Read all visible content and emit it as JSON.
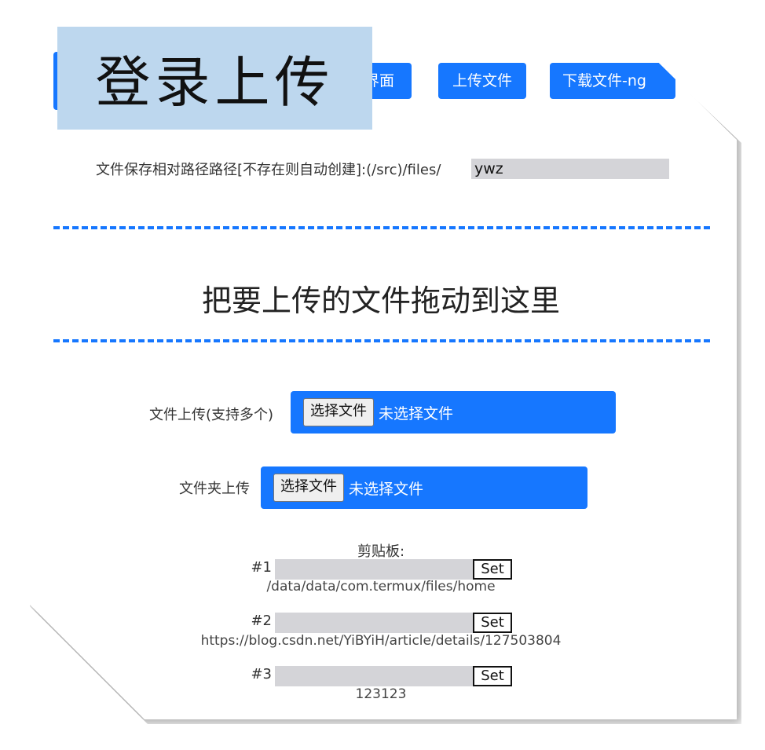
{
  "overlay": {
    "title": "登录上传"
  },
  "nav": {
    "login_label": "",
    "ui_label": "界面",
    "upload_label": "上传文件",
    "download_label": "下载文件-ng"
  },
  "path": {
    "label": "文件保存相对路径路径[不存在则自动创建]:(/src)/files/",
    "value": "ywz"
  },
  "dropzone": {
    "text": "把要上传的文件拖动到这里"
  },
  "file_upload": {
    "label": "文件上传(支持多个)",
    "button": "选择文件",
    "status": "未选择文件"
  },
  "folder_upload": {
    "label": "文件夹上传",
    "button": "选择文件",
    "status": "未选择文件"
  },
  "clipboard": {
    "title": "剪贴板:",
    "items": [
      {
        "label": "#1",
        "set": "Set",
        "value": "/data/data/com.termux/files/home"
      },
      {
        "label": "#2",
        "set": "Set",
        "value": "https://blog.csdn.net/YiBYiH/article/details/127503804"
      },
      {
        "label": "#3",
        "set": "Set",
        "value": "123123"
      }
    ]
  },
  "colors": {
    "accent": "#1677ff",
    "overlay_bg": "#bdd7ee",
    "input_bg": "#d4d4d8"
  }
}
